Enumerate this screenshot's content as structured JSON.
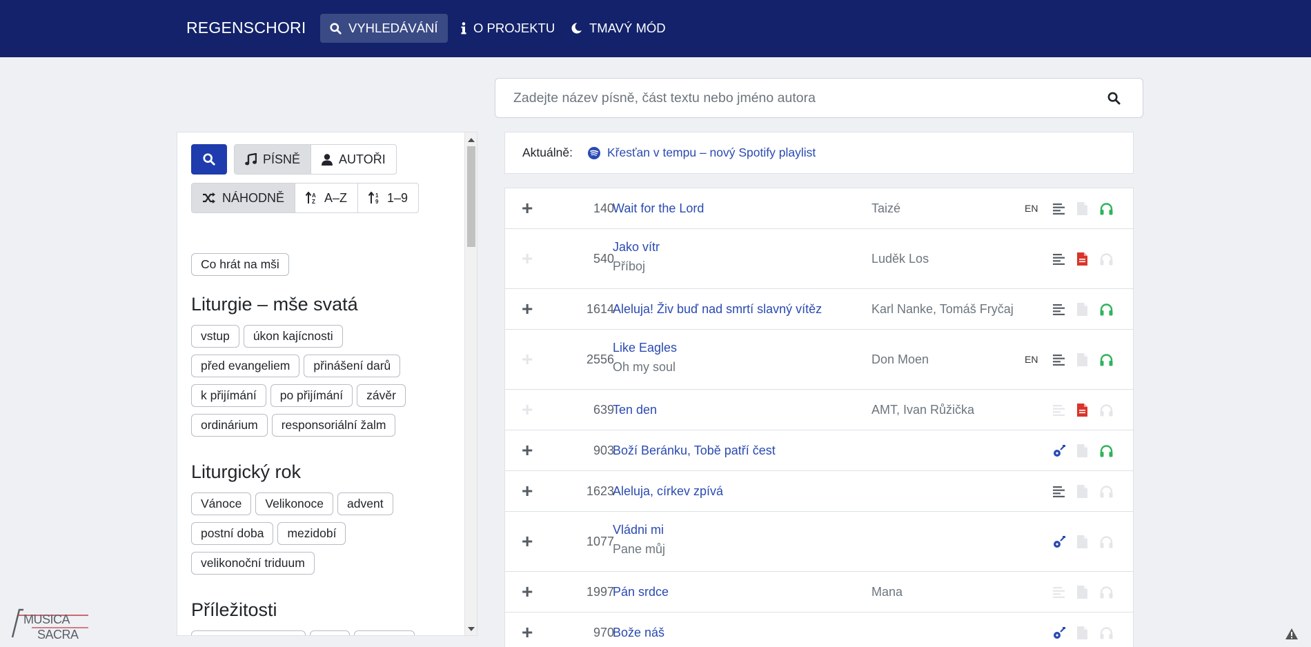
{
  "navbar": {
    "brand": "REGENSCHORI",
    "items": [
      {
        "label": "VYHLEDÁVÁNÍ",
        "icon": "search-icon",
        "active": true
      },
      {
        "label": "O PROJEKTU",
        "icon": "info-icon",
        "active": false
      },
      {
        "label": "TMAVÝ MÓD",
        "icon": "moon-icon",
        "active": false
      }
    ]
  },
  "search": {
    "placeholder": "Zadejte název písně, část textu nebo jméno autora",
    "value": ""
  },
  "filters": {
    "type_buttons": [
      {
        "label": "PÍSNĚ",
        "icon": "music-note-icon",
        "active": true
      },
      {
        "label": "AUTOŘI",
        "icon": "user-icon",
        "active": false
      }
    ],
    "sort_buttons": [
      {
        "label": "NÁHODNĚ",
        "icon": "shuffle-icon",
        "active": true
      },
      {
        "label": "A–Z",
        "icon": "sort-alpha-icon",
        "active": false
      },
      {
        "label": "1–9",
        "icon": "sort-numeric-icon",
        "active": false
      }
    ],
    "top_tag": "Co hrát na mši",
    "sections": [
      {
        "title": "Liturgie – mše svatá",
        "tags": [
          "vstup",
          "úkon kajícnosti",
          "před evangeliem",
          "přinášení darů",
          "k přijímání",
          "po přijímání",
          "závěr",
          "ordinárium",
          "responsoriální žalm"
        ]
      },
      {
        "title": "Liturgický rok",
        "tags": [
          "Vánoce",
          "Velikonoce",
          "advent",
          "postní doba",
          "mezidobí",
          "velikonoční triduum"
        ]
      },
      {
        "title": "Příležitosti",
        "tags": []
      }
    ]
  },
  "news": {
    "label": "Aktuálně:",
    "link_text": "Křesťan v tempu – nový Spotify playlist",
    "link_icon": "spotify-icon"
  },
  "songs": [
    {
      "num": "140",
      "title": "Wait for the Lord",
      "subtitle": "",
      "author": "Taizé",
      "lang": "EN",
      "add_enabled": true,
      "lyrics": "active",
      "pdf": false,
      "audio": true
    },
    {
      "num": "540",
      "title": "Jako vítr",
      "subtitle": "Příboj",
      "author": "Luděk Los",
      "lang": "",
      "add_enabled": false,
      "lyrics": "active",
      "pdf": true,
      "audio": false
    },
    {
      "num": "1614",
      "title": "Aleluja! Živ buď nad smrtí slavný vítěz",
      "subtitle": "",
      "author": "Karl Nanke, Tomáš Fryčaj",
      "lang": "",
      "add_enabled": true,
      "lyrics": "active",
      "pdf": false,
      "audio": true
    },
    {
      "num": "2556",
      "title": "Like Eagles",
      "subtitle": "Oh my soul",
      "author": "Don Moen",
      "lang": "EN",
      "add_enabled": false,
      "lyrics": "active",
      "pdf": false,
      "audio": true
    },
    {
      "num": "639",
      "title": "Ten den",
      "subtitle": "",
      "author": "AMT, Ivan Růžička",
      "lang": "",
      "add_enabled": false,
      "lyrics": "inactive",
      "pdf": true,
      "audio": false
    },
    {
      "num": "903",
      "title": "Boží Beránku, Tobě patří čest",
      "subtitle": "",
      "author": "",
      "lang": "",
      "add_enabled": true,
      "lyrics": "chords",
      "pdf": false,
      "audio": true
    },
    {
      "num": "1623",
      "title": "Aleluja, církev zpívá",
      "subtitle": "",
      "author": "",
      "lang": "",
      "add_enabled": true,
      "lyrics": "active",
      "pdf": false,
      "audio": false
    },
    {
      "num": "1077",
      "title": "Vládni mi",
      "subtitle": "Pane můj",
      "author": "",
      "lang": "",
      "add_enabled": true,
      "lyrics": "chords",
      "pdf": false,
      "audio": false
    },
    {
      "num": "1997",
      "title": "Pán srdce",
      "subtitle": "",
      "author": "Mana",
      "lang": "",
      "add_enabled": true,
      "lyrics": "inactive",
      "pdf": false,
      "audio": false
    },
    {
      "num": "970",
      "title": "Bože náš",
      "subtitle": "",
      "author": "",
      "lang": "",
      "add_enabled": true,
      "lyrics": "chords",
      "pdf": false,
      "audio": false
    }
  ],
  "colors": {
    "navbar": "#13226a",
    "accent": "#2a4ab1",
    "audio_active": "#2fb35a",
    "pdf_active": "#d9342b",
    "inactive_icon": "#e4e6e9"
  },
  "logo": {
    "text_line1": "MUSICA",
    "text_line2": "SACRA"
  }
}
